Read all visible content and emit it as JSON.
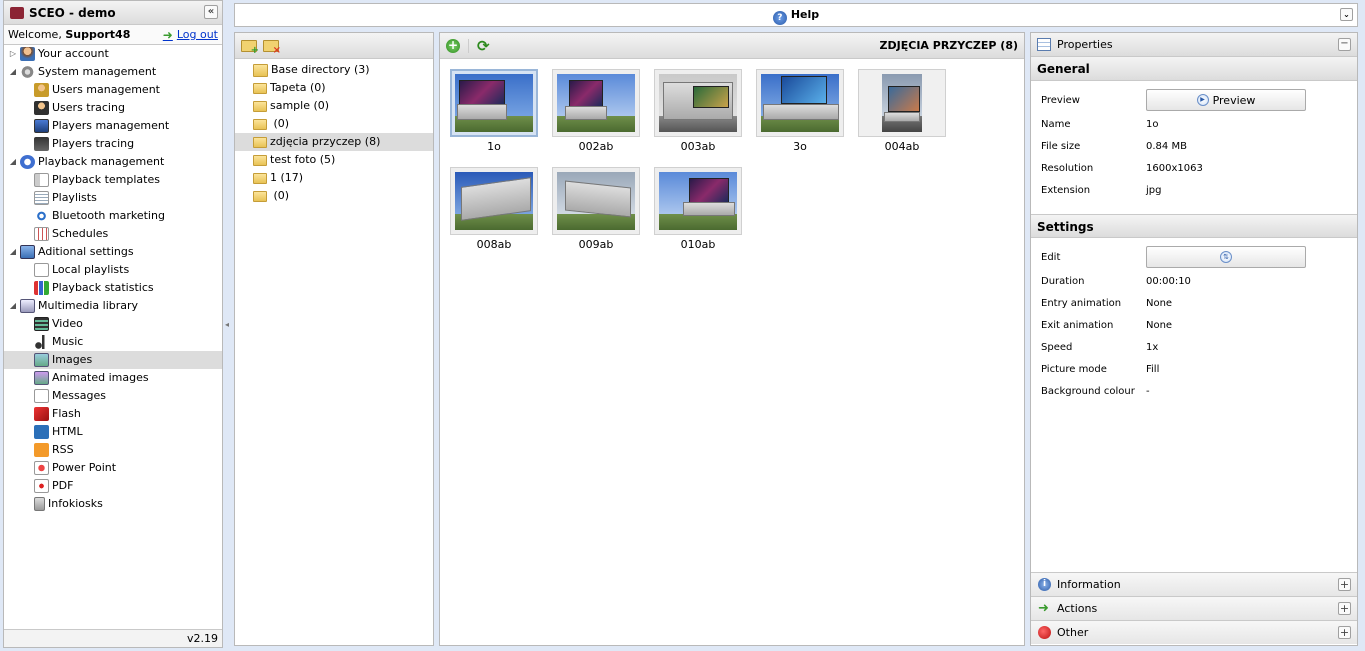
{
  "app": {
    "title": "SCEO - demo",
    "collapse_glyph": "«",
    "welcome_prefix": "Welcome, ",
    "username": "Support48",
    "logout_label": "Log out",
    "version": "v2.19"
  },
  "nav": {
    "your_account": "Your account",
    "system_management": "System management",
    "users_management": "Users management",
    "users_tracing": "Users tracing",
    "players_management": "Players management",
    "players_tracing": "Players tracing",
    "playback_management": "Playback management",
    "playback_templates": "Playback templates",
    "playlists": "Playlists",
    "bluetooth_marketing": "Bluetooth marketing",
    "schedules": "Schedules",
    "aditional_settings": "Aditional settings",
    "local_playlists": "Local playlists",
    "playback_statistics": "Playback statistics",
    "multimedia_library": "Multimedia library",
    "video": "Video",
    "music": "Music",
    "images": "Images",
    "animated_images": "Animated images",
    "messages": "Messages",
    "flash": "Flash",
    "html": "HTML",
    "rss": "RSS",
    "power_point": "Power Point",
    "pdf": "PDF",
    "infokiosks": "Infokiosks"
  },
  "help": {
    "label": "Help"
  },
  "directories": [
    {
      "label": "Base directory (3)"
    },
    {
      "label": "Tapeta (0)"
    },
    {
      "label": "sample (0)"
    },
    {
      "label": " (0)"
    },
    {
      "label": "zdjęcia przyczep (8)"
    },
    {
      "label": "test foto (5)"
    },
    {
      "label": "1 (17)"
    },
    {
      "label": " (0)"
    }
  ],
  "images_panel": {
    "folder_title": "ZDJĘCIA PRZYCZEP (8)",
    "thumbnails": [
      "1o",
      "002ab",
      "003ab",
      "3o",
      "004ab",
      "008ab",
      "009ab",
      "010ab"
    ]
  },
  "properties": {
    "title": "Properties",
    "general_title": "General",
    "preview_label": "Preview",
    "preview_button": "Preview",
    "name_label": "Name",
    "name_value": "1o",
    "filesize_label": "File size",
    "filesize_value": "0.84 MB",
    "resolution_label": "Resolution",
    "resolution_value": "1600x1063",
    "extension_label": "Extension",
    "extension_value": "jpg",
    "settings_title": "Settings",
    "edit_label": "Edit",
    "duration_label": "Duration",
    "duration_value": "00:00:10",
    "entry_label": "Entry animation",
    "entry_value": "None",
    "exit_label": "Exit animation",
    "exit_value": "None",
    "speed_label": "Speed",
    "speed_value": "1x",
    "picture_label": "Picture mode",
    "picture_value": "Fill",
    "bg_label": "Background colour",
    "bg_value": "-",
    "information": "Information",
    "actions": "Actions",
    "other": "Other"
  }
}
